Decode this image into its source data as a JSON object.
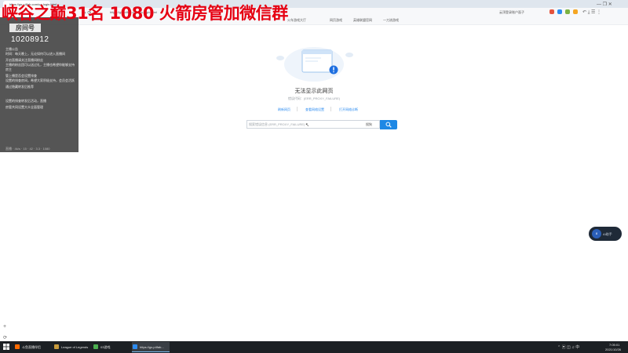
{
  "stream": {
    "title": "峡谷之巅31名 1080 火箭房管加微信群",
    "room_label": "房间号",
    "room_number": "10208912",
    "panel_lines": [
      "主播公告",
      "时间：每天晚上，无论如何可以进入直播间",
      "",
      "开启直播请关注直播间粉丝",
      "主播的粉丝团可以送过礼，主播也希望你能够支持",
      "房主",
      "管上播是否会设置排查",
      "设置的排查房间，希望大家积极支持，会员会活跃",
      "通过隐藏转发后推荐",
      "",
      "设置的排查转发后活动，直播",
      "房管共同设置大众全面管理"
    ],
    "panel_footer": "直播 · 4k/s · 15 · 42 · 3.3 · 1080"
  },
  "browser": {
    "tab_title": "https://gs.p4fab.com/ua-login.html",
    "address": "https://gs.p4fab.com/ua-login.html",
    "toolbar_search": "云顶登录账户面子",
    "bookmarks": [
      "火车游戏大厅",
      "网页游戏",
      "英雄联盟官网",
      "一刀流游戏"
    ]
  },
  "error_page": {
    "title": "无法显示此网页",
    "subtitle": "错误代码：(ERR_PROXY_FAILURE)",
    "links": [
      "刷新网页",
      "查看网络设置",
      "打开网络诊断"
    ],
    "search_placeholder": "搜索错误信息 (ERR_PROXY_FAILURE)",
    "search_engine": "搜狗"
  },
  "widget": {
    "badge": "8",
    "text": "AI助手"
  },
  "taskbar": {
    "items": [
      "斗鱼直播伴侣",
      "League of Legends",
      "03游戏",
      "https://gs.p4fab..."
    ],
    "time": "7:05:01",
    "date": "2021/10/26"
  },
  "colors": {
    "title_red": "#e60012",
    "link_blue": "#2d8cf0",
    "search_button": "#1e88e5",
    "taskbar": "#1c2024"
  },
  "icons": [
    "search-icon",
    "alert-icon",
    "plus-icon",
    "refresh-icon",
    "windows-start-icon"
  ]
}
